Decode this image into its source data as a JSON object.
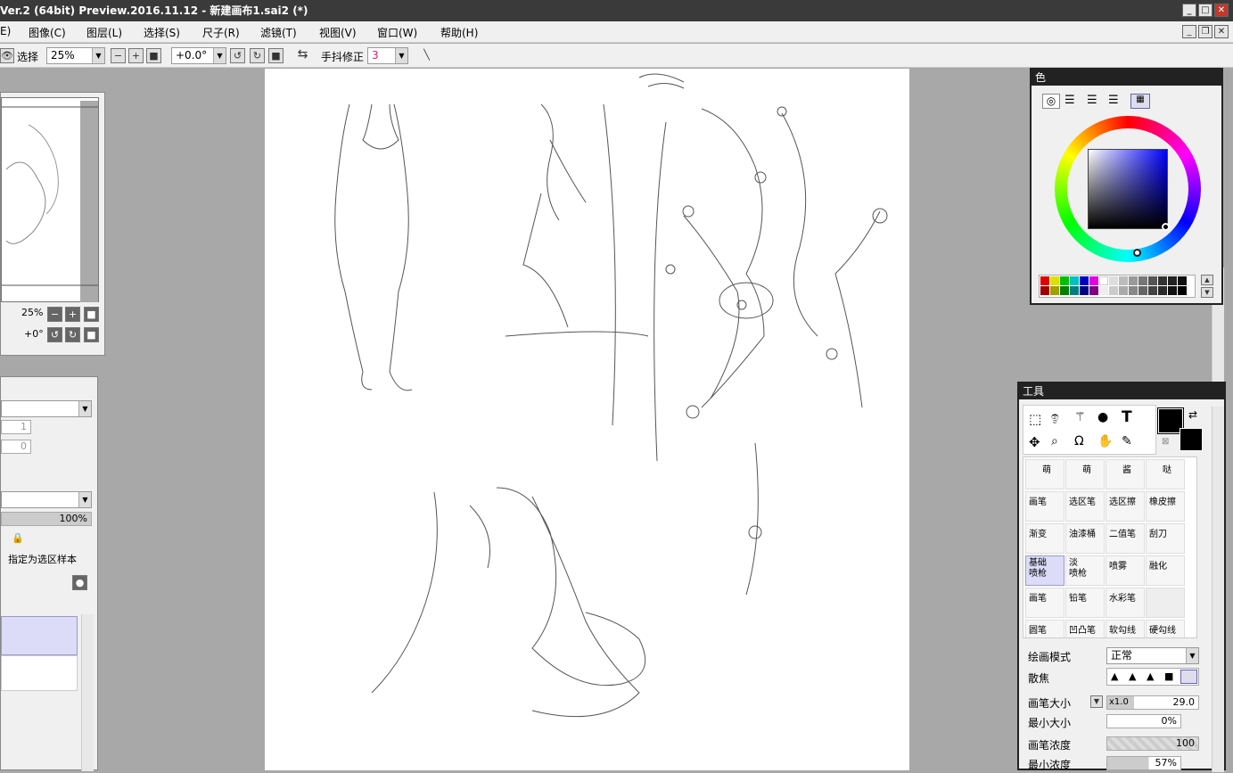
{
  "window": {
    "title": "Ver.2 (64bit) Preview.2016.11.12 - 新建画布1.sai2 (*)"
  },
  "menu": [
    "E)",
    "图像(C)",
    "图层(L)",
    "选择(S)",
    "尺子(R)",
    "滤镜(T)",
    "视图(V)",
    "窗口(W)",
    "帮助(H)"
  ],
  "toolbar": {
    "select_label": "选择",
    "zoom": "25%",
    "rotation": "+0.0°",
    "stabilizer_label": "手抖修正",
    "stabilizer_value": "3"
  },
  "navigator": {
    "zoom": "25%",
    "rotation": "+0°"
  },
  "layer_panel": {
    "value1": "1",
    "value2": "0",
    "opacity": "100%",
    "sample_label": "指定为选区样本"
  },
  "color_panel": {
    "title": "色",
    "accent": "#0000ff"
  },
  "tool_panel": {
    "title": "工具",
    "tool_icons": [
      "rect-select-icon",
      "lasso-icon",
      "magic-wand-icon",
      "shape-icon",
      "text-icon",
      "move-icon",
      "zoom-icon",
      "rotate-icon",
      "hand-icon",
      "eyedropper-icon"
    ],
    "presets": [
      "萌",
      "萌",
      "酱",
      "哒"
    ],
    "brushes": [
      "画笔",
      "选区笔",
      "选区擦",
      "橡皮擦",
      "渐变",
      "油漆桶",
      "二值笔",
      "刮刀",
      "基础\n喷枪",
      "淡\n喷枪",
      "喷雾",
      "融化",
      "画笔",
      "铅笔",
      "水彩笔",
      "",
      "圆笔",
      "凹凸笔",
      "软勾线笔",
      "硬勾线笔"
    ],
    "draw_mode_label": "绘画模式",
    "draw_mode_value": "正常",
    "blur_label": "散焦",
    "brush_size_label": "画笔大小",
    "brush_size_mult": "x1.0",
    "brush_size_value": "29.0",
    "min_size_label": "最小大小",
    "min_size_value": "0%",
    "density_label": "画笔浓度",
    "density_value": "100",
    "min_density_label": "最小浓度",
    "min_density_value": "57%"
  }
}
